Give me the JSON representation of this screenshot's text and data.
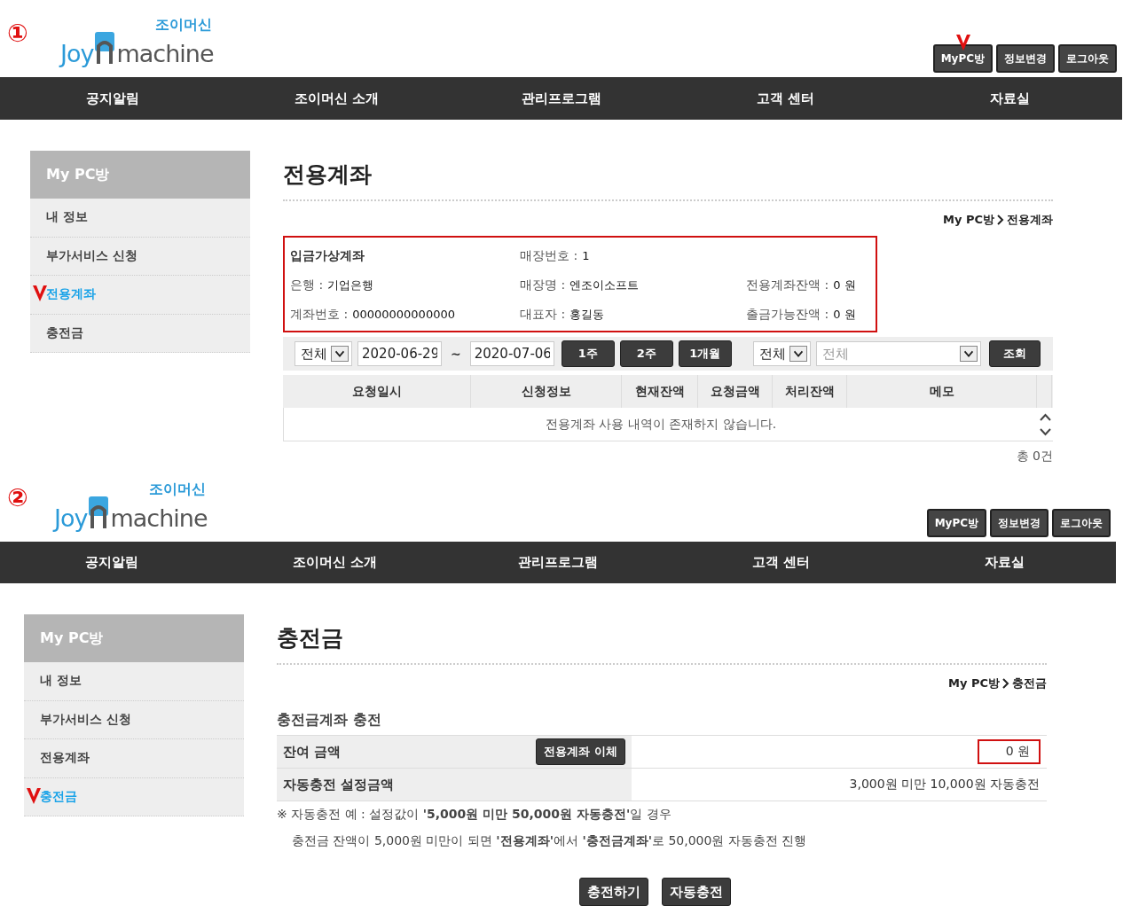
{
  "panels": [
    {
      "marker": "①",
      "logo": {
        "brand": "조이머신",
        "word_start": "Joy",
        "word_end": "machine"
      },
      "top_buttons": [
        {
          "label": "MyPC방",
          "annotated": true
        },
        {
          "label": "정보변경",
          "annotated": false
        },
        {
          "label": "로그아웃",
          "annotated": false
        }
      ],
      "nav": [
        "공지알림",
        "조이머신 소개",
        "관리프로그램",
        "고객 센터",
        "자료실"
      ],
      "sidebar": {
        "title": "My PC방",
        "items": [
          {
            "label": "내 정보",
            "selected": false
          },
          {
            "label": "부가서비스 신청",
            "selected": false
          },
          {
            "label": "전용계좌",
            "selected": true
          },
          {
            "label": "충전금",
            "selected": false
          }
        ]
      },
      "content": {
        "kind": "account",
        "title": "전용계좌",
        "breadcrumb": [
          "My PC방",
          "전용계좌"
        ],
        "info_box": {
          "rows": [
            [
              {
                "kind": "heading",
                "text": "입금가상계좌"
              },
              {
                "kind": "field",
                "label": "매장번호 :",
                "value": "1"
              }
            ],
            [
              {
                "kind": "field",
                "label": "은행 :",
                "value": "기업은행"
              },
              {
                "kind": "field",
                "label": "매장명 :",
                "value": "엔조이소프트"
              },
              {
                "kind": "field",
                "label": "전용계좌잔액 :",
                "value": "0 원"
              }
            ],
            [
              {
                "kind": "field",
                "label": "계좌번호 :",
                "value": "00000000000000"
              },
              {
                "kind": "field",
                "label": "대표자 :",
                "value": "홍길동"
              },
              {
                "kind": "field",
                "label": "출금가능잔액 :",
                "value": "0 원"
              }
            ]
          ]
        },
        "filter": {
          "type_select": "전체",
          "date_from": "2020-06-29",
          "separator": "~",
          "date_to": "2020-07-06",
          "period_buttons": [
            "1주",
            "2주",
            "1개월"
          ],
          "status_select": "전체",
          "detail_select": "전체",
          "search_button": "조회"
        },
        "table": {
          "columns": [
            "요청일시",
            "신청정보",
            "현재잔액",
            "요청금액",
            "처리잔액",
            "메모"
          ],
          "empty_message": "전용계좌 사용 내역이 존재하지 않습니다."
        },
        "total": "총 0건"
      }
    },
    {
      "marker": "②",
      "logo": {
        "brand": "조이머신",
        "word_start": "Joy",
        "word_end": "machine"
      },
      "top_buttons": [
        {
          "label": "MyPC방",
          "annotated": false
        },
        {
          "label": "정보변경",
          "annotated": false
        },
        {
          "label": "로그아웃",
          "annotated": false
        }
      ],
      "nav": [
        "공지알림",
        "조이머신 소개",
        "관리프로그램",
        "고객 센터",
        "자료실"
      ],
      "sidebar": {
        "title": "My PC방",
        "items": [
          {
            "label": "내 정보",
            "selected": false
          },
          {
            "label": "부가서비스 신청",
            "selected": false
          },
          {
            "label": "전용계좌",
            "selected": false
          },
          {
            "label": "충전금",
            "selected": true
          }
        ]
      },
      "content": {
        "kind": "charge",
        "title": "충전금",
        "breadcrumb": [
          "My PC방",
          "충전금"
        ],
        "section_title": "충전금계좌 충전",
        "rows": [
          {
            "label": "잔여 금액",
            "button": "전용계좌 이체",
            "value": "0 원",
            "highlighted": true
          },
          {
            "label": "자동충전 설정금액",
            "value": "3,000원 미만 10,000원 자동충전",
            "highlighted": false
          }
        ],
        "notes": [
          "※ 자동충전 예 : 설정값이 **'5,000원 미만 50,000원 자동충전'**일 경우",
          "충전금 잔액이 5,000원 미만이 되면 **'전용계좌'**에서 **'충전금계좌'**로 50,000원 자동충전 진행"
        ],
        "actions": [
          "충전하기",
          "자동충전"
        ]
      }
    }
  ]
}
